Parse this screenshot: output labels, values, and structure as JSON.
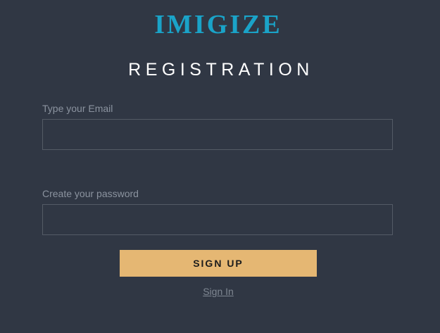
{
  "brand": {
    "logo_text": "IMIGIZE",
    "accent_color": "#1aa3c8"
  },
  "form": {
    "title": "REGISTRATION",
    "email_label": "Type your Email",
    "email_value": "",
    "password_label": "Create your password",
    "password_value": "",
    "submit_label": "SIGN UP",
    "submit_color": "#e5b773",
    "signin_link": "Sign In"
  },
  "theme": {
    "background": "#303744"
  }
}
